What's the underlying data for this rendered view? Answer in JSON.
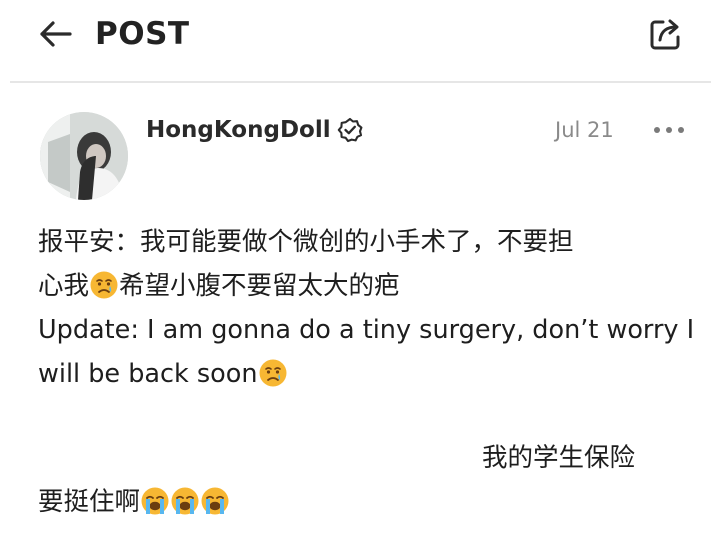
{
  "header": {
    "title": "POST",
    "back_icon": "arrow-left-icon",
    "share_icon": "share-icon"
  },
  "post": {
    "username": "HongKongDoll",
    "date": "Jul 21",
    "verified_icon": "verified-badge-icon",
    "more_icon": "more-dots-icon",
    "lines": {
      "line1": "报平安：我可能要做个微创的小手术了，不要担",
      "line2a": "心我",
      "line2b": "希望小腹不要留太大的疤",
      "line3": "Update: I am gonna do a tiny surgery, don’t worry I",
      "line4": "will be back soon",
      "line5": "我的学生保险",
      "line6": "要挺住啊"
    },
    "emojis": {
      "sad": "crying-face-emoji",
      "loud": "loudly-crying-face-emoji"
    }
  },
  "colors": {
    "text": "#1e1e1e",
    "muted": "#8a8a8a",
    "divider": "#e6e6e6",
    "emoji_yellow": "#f7b733"
  }
}
